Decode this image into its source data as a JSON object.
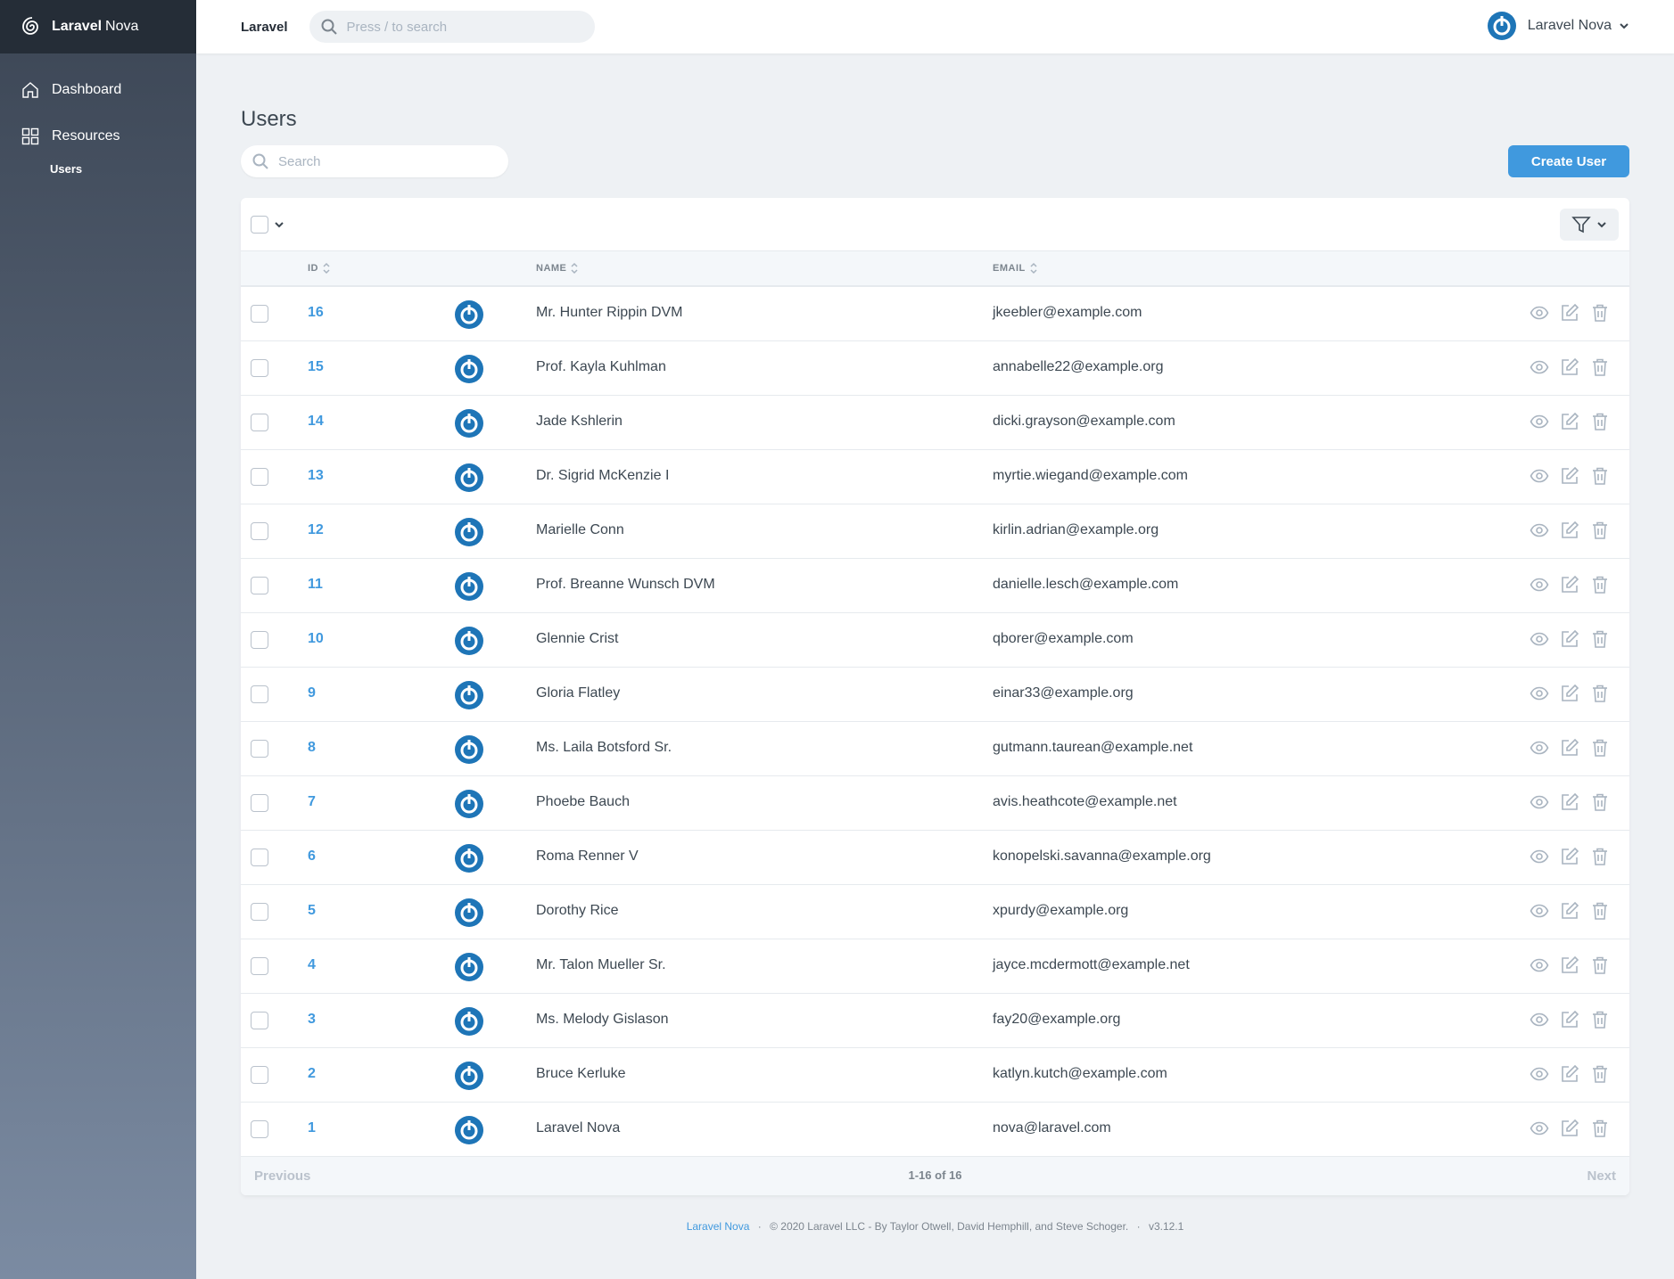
{
  "brand": {
    "name_bold": "Laravel",
    "name_light": "Nova"
  },
  "sidebar": {
    "items": [
      {
        "label": "Dashboard",
        "icon": "home-icon"
      },
      {
        "label": "Resources",
        "icon": "grid-icon"
      }
    ],
    "sub_items": [
      {
        "label": "Users"
      }
    ]
  },
  "header": {
    "app_name": "Laravel",
    "search_placeholder": "Press / to search",
    "user_name": "Laravel Nova"
  },
  "page": {
    "title": "Users",
    "search_placeholder": "Search",
    "create_button": "Create User"
  },
  "table": {
    "columns": {
      "id": "ID",
      "name": "NAME",
      "email": "EMAIL"
    },
    "rows": [
      {
        "id": "16",
        "name": "Mr. Hunter Rippin DVM",
        "email": "jkeebler@example.com"
      },
      {
        "id": "15",
        "name": "Prof. Kayla Kuhlman",
        "email": "annabelle22@example.org"
      },
      {
        "id": "14",
        "name": "Jade Kshlerin",
        "email": "dicki.grayson@example.com"
      },
      {
        "id": "13",
        "name": "Dr. Sigrid McKenzie I",
        "email": "myrtie.wiegand@example.com"
      },
      {
        "id": "12",
        "name": "Marielle Conn",
        "email": "kirlin.adrian@example.org"
      },
      {
        "id": "11",
        "name": "Prof. Breanne Wunsch DVM",
        "email": "danielle.lesch@example.com"
      },
      {
        "id": "10",
        "name": "Glennie Crist",
        "email": "qborer@example.com"
      },
      {
        "id": "9",
        "name": "Gloria Flatley",
        "email": "einar33@example.org"
      },
      {
        "id": "8",
        "name": "Ms. Laila Botsford Sr.",
        "email": "gutmann.taurean@example.net"
      },
      {
        "id": "7",
        "name": "Phoebe Bauch",
        "email": "avis.heathcote@example.net"
      },
      {
        "id": "6",
        "name": "Roma Renner V",
        "email": "konopelski.savanna@example.org"
      },
      {
        "id": "5",
        "name": "Dorothy Rice",
        "email": "xpurdy@example.org"
      },
      {
        "id": "4",
        "name": "Mr. Talon Mueller Sr.",
        "email": "jayce.mcdermott@example.net"
      },
      {
        "id": "3",
        "name": "Ms. Melody Gislason",
        "email": "fay20@example.org"
      },
      {
        "id": "2",
        "name": "Bruce Kerluke",
        "email": "katlyn.kutch@example.com"
      },
      {
        "id": "1",
        "name": "Laravel Nova",
        "email": "nova@laravel.com"
      }
    ]
  },
  "pagination": {
    "previous": "Previous",
    "info": "1-16 of 16",
    "next": "Next"
  },
  "footer": {
    "link": "Laravel Nova",
    "separator": "·",
    "copyright": "© 2020 Laravel LLC - By Taylor Otwell, David Hemphill, and Steve Schoger.",
    "version": "v3.12.1"
  },
  "colors": {
    "accent": "#4099de",
    "sidebar_top": "#3c4655",
    "sidebar_bottom": "#7b8ba2",
    "avatar": "#1e75b7"
  }
}
